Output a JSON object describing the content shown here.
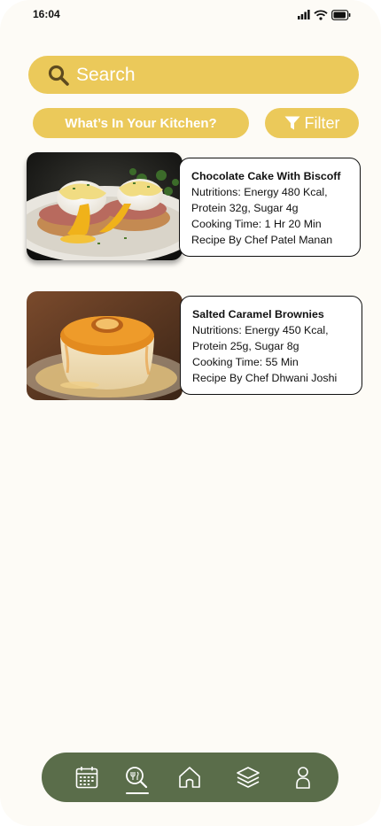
{
  "status": {
    "time": "16:04"
  },
  "search": {
    "placeholder": "Search"
  },
  "actions": {
    "kitchen_label": "What’s In Your Kitchen?",
    "filter_label": "Filter"
  },
  "recipes": [
    {
      "title": "Chocolate Cake With Biscoff",
      "nutrition_line1": "Nutritions: Energy 480 Kcal,",
      "nutrition_line2": "Protein 32g, Sugar 4g",
      "cooking_time": "Cooking Time: 1 Hr 20 Min",
      "chef": "Recipe By Chef Patel Manan",
      "image": "eggs-benedict-photo"
    },
    {
      "title": "Salted Caramel Brownies",
      "nutrition_line1": "Nutritions: Energy 450 Kcal,",
      "nutrition_line2": "Protein 25g, Sugar 8g",
      "cooking_time": "Cooking Time: 55 Min",
      "chef": "Recipe By Chef Dhwani Joshi",
      "image": "caramel-flan-photo"
    }
  ],
  "nav": {
    "items": [
      "calendar-icon",
      "recipe-search-icon",
      "home-icon",
      "layers-icon",
      "profile-icon"
    ],
    "active": "recipe-search-icon"
  },
  "colors": {
    "accent": "#ebc95a",
    "nav_bg": "#5a6d4a",
    "page_bg": "#fdfbf6"
  }
}
